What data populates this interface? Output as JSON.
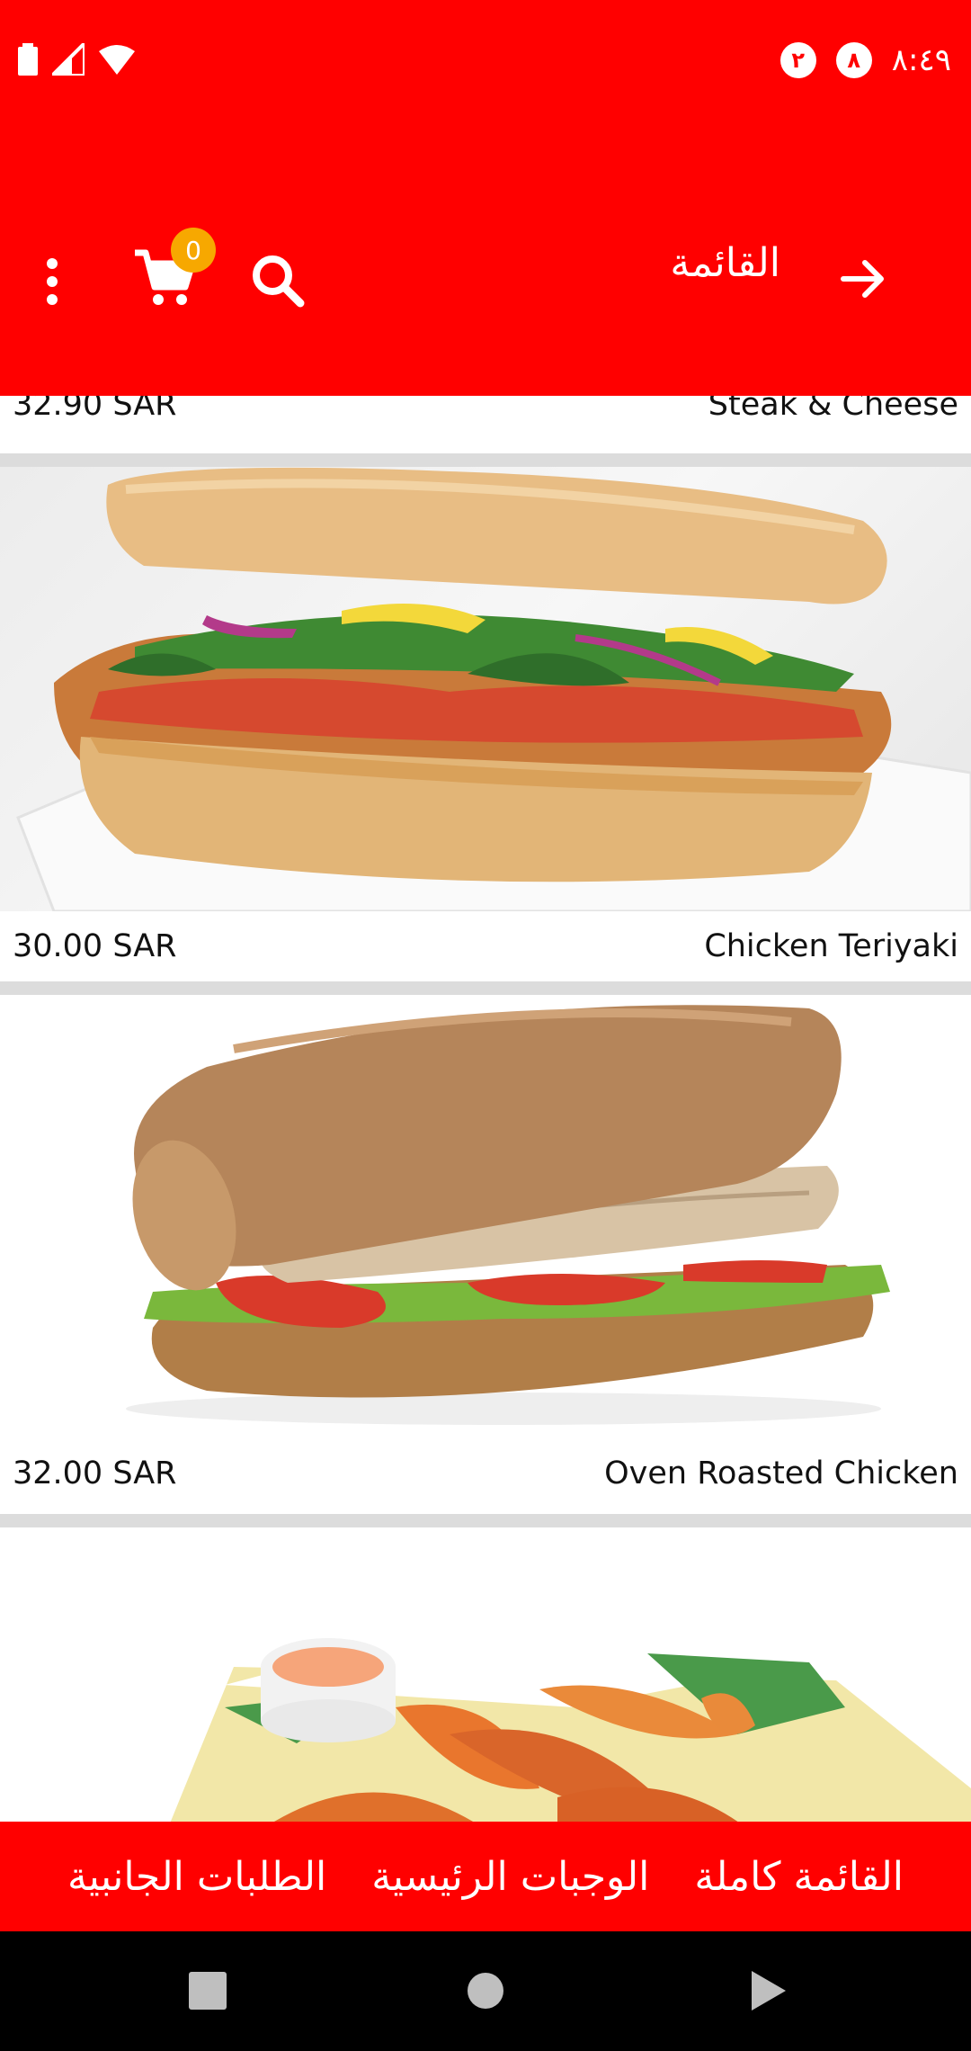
{
  "status_bar": {
    "time": "٨:٤٩",
    "notif_1": "٨",
    "notif_2": "٢"
  },
  "toolbar": {
    "title": "القائمة",
    "cart_count": "0"
  },
  "menu": {
    "partial_top": {
      "name": "Steak & Cheese",
      "price": "32.90 SAR"
    },
    "items": [
      {
        "name": "Chicken Teriyaki",
        "price": "30.00 SAR"
      },
      {
        "name": "Oven Roasted Chicken",
        "price": "32.00 SAR"
      }
    ]
  },
  "categories": [
    "القائمة كاملة",
    "الوجبات الرئيسية",
    "الطلبات الجانبية"
  ],
  "colors": {
    "primary": "#ff0000",
    "badge": "#f7a800",
    "divider": "#dcdcdc"
  }
}
